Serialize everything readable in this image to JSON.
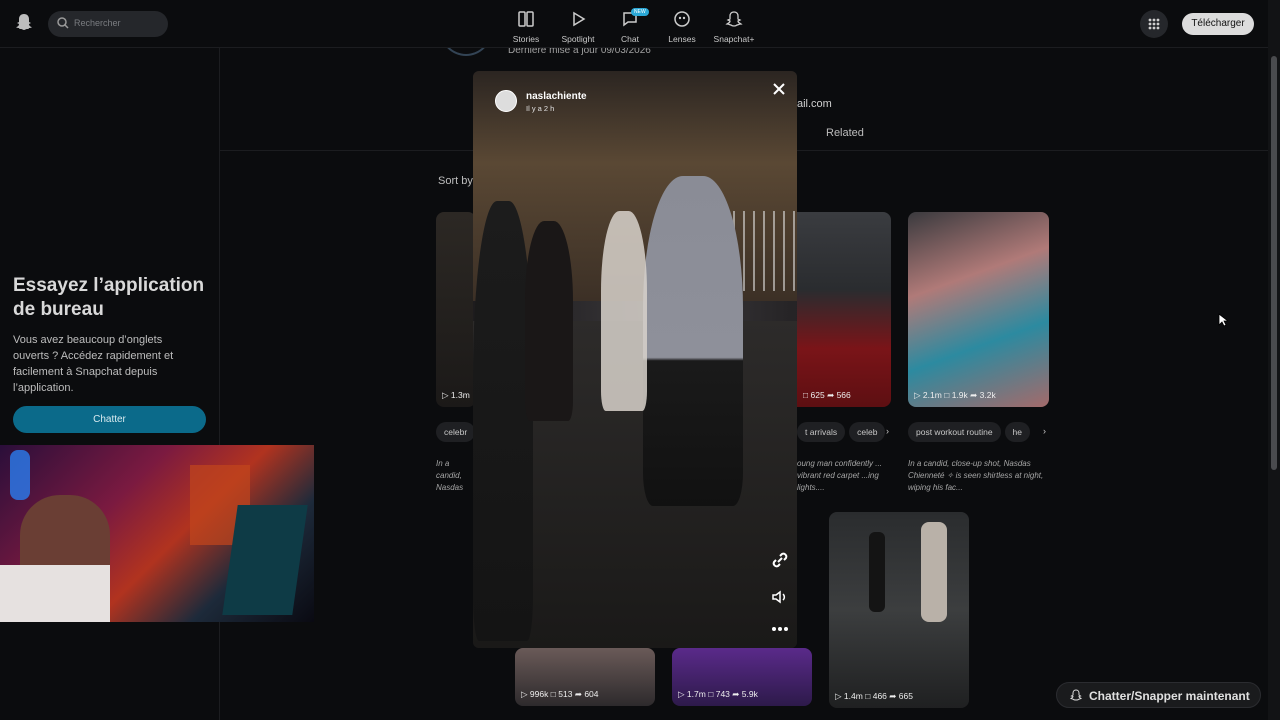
{
  "topbar": {
    "search_placeholder": "Rechercher",
    "nav": [
      {
        "label": "Stories",
        "icon": "stories-icon"
      },
      {
        "label": "Spotlight",
        "icon": "play-icon"
      },
      {
        "label": "Chat",
        "icon": "chat-icon",
        "badge": "NEW"
      },
      {
        "label": "Lenses",
        "icon": "lenses-icon"
      },
      {
        "label": "Snapchat+",
        "icon": "snapchat-plus-icon"
      }
    ],
    "download_label": "Télécharger"
  },
  "sidebar": {
    "promo_title": "Essayez l’application de bureau",
    "promo_text": "Vous avez beaucoup d’onglets ouverts ? Accédez rapidement et facilement à Snapchat depuis l’application.",
    "chat_button": "Chatter"
  },
  "profile": {
    "last_update": "Dernière mise à jour 09/03/2026",
    "email_fragment": "ail.com",
    "tab_related": "Related",
    "sort_label": "Sort by"
  },
  "cards": [
    {
      "stats": {
        "views": "1.3m"
      },
      "tags": [
        "celebr"
      ],
      "desc": "In a candid, Nasdas C... a victory v..."
    },
    {
      "stats": {
        "comments": "625",
        "shares": "566"
      },
      "tags": [
        "t arrivals",
        "celeb"
      ],
      "desc": "oung man confidently ... vibrant red carpet ...ing lights...."
    },
    {
      "stats": {
        "views": "2.1m",
        "comments": "1.9k",
        "shares": "3.2k"
      },
      "tags": [
        "post workout routine",
        "he"
      ],
      "desc": "In a candid, close-up shot, Nasdas Chienneté ✧ is seen shirtless at night, wiping his fac..."
    },
    {
      "stats": {
        "views": "996k",
        "comments": "513",
        "shares": "604"
      }
    },
    {
      "stats": {
        "views": "1.7m",
        "comments": "743",
        "shares": "5.9k"
      }
    },
    {
      "stats": {
        "views": "1.4m",
        "comments": "466",
        "shares": "665"
      }
    }
  ],
  "viewer": {
    "username": "naslachiente",
    "time_ago": "Il y a 2 h",
    "actions": [
      "link-icon",
      "volume-icon",
      "more-icon"
    ]
  },
  "floating_button": "Chatter/Snapper maintenant"
}
